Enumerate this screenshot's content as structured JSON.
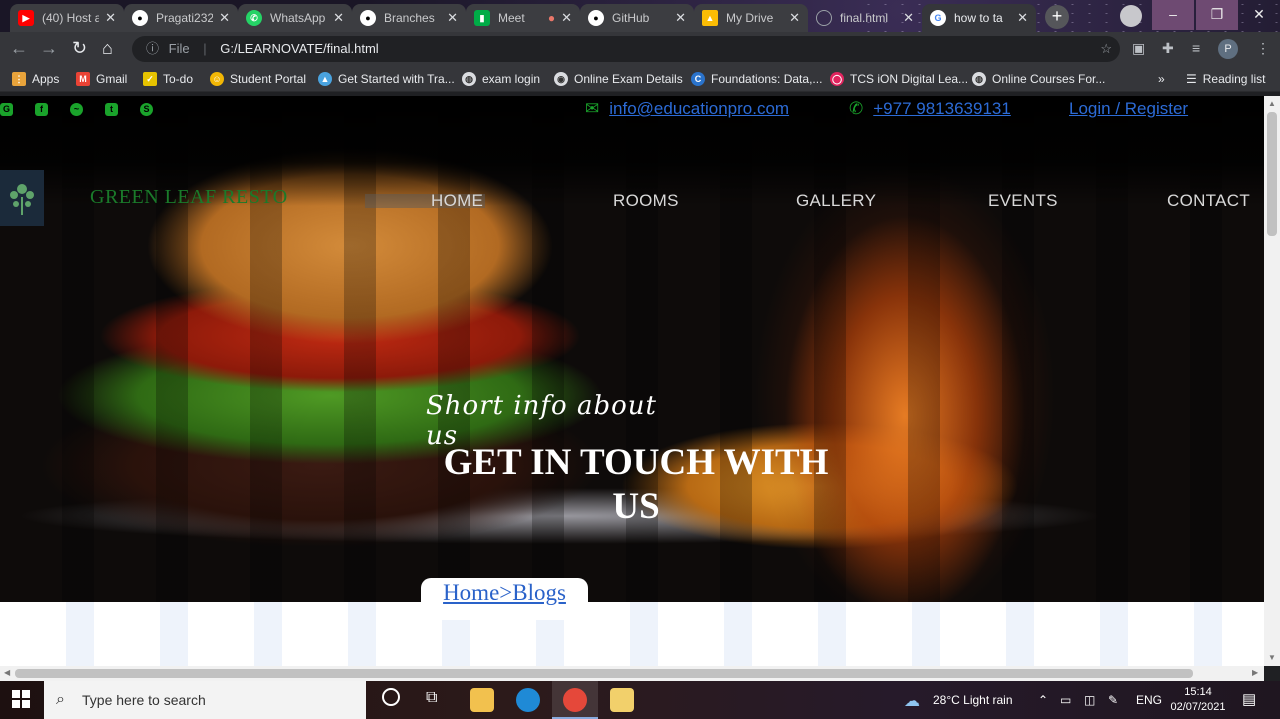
{
  "browser": {
    "tabs": [
      {
        "label": "(40) Host a",
        "icon_color": "#ff0000",
        "icon": "youtube-icon"
      },
      {
        "label": "Pragati232",
        "icon_color": "#ffffff",
        "icon": "github-icon"
      },
      {
        "label": "WhatsApp",
        "icon_color": "#25d366",
        "icon": "whatsapp-icon"
      },
      {
        "label": "Branches",
        "icon_color": "#ffffff",
        "icon": "github-icon"
      },
      {
        "label": "Meet",
        "icon_color": "#00ac47",
        "icon": "meet-icon"
      },
      {
        "label": "GitHub",
        "icon_color": "#ffffff",
        "icon": "github-icon"
      },
      {
        "label": "My Drive",
        "icon_color": "#fbbc04",
        "icon": "drive-icon"
      },
      {
        "label": "final.html",
        "icon_color": "#9aa0a6",
        "icon": "globe-icon"
      },
      {
        "label": "how to ta",
        "icon_color": "#4285f4",
        "icon": "google-icon"
      }
    ],
    "address": {
      "prefix": "File",
      "url": "G:/LEARNOVATE/final.html"
    },
    "profile_initial": "P",
    "bookmarks": [
      {
        "label": "Apps",
        "icon": "apps-grid-icon",
        "color": "#e8a33b"
      },
      {
        "label": "Gmail",
        "icon": "gmail-icon",
        "color": "#ea4335"
      },
      {
        "label": "To-do",
        "icon": "todo-icon",
        "color": "#e6c300"
      },
      {
        "label": "Student Portal",
        "icon": "portal-icon",
        "color": "#f2b705"
      },
      {
        "label": "Get Started with Tra...",
        "icon": "triangle-icon",
        "color": "#4aa3df"
      },
      {
        "label": "exam login",
        "icon": "globe-icon",
        "color": "#dadce0"
      },
      {
        "label": "Online Exam Details",
        "icon": "exam-icon",
        "color": "#dadce0"
      },
      {
        "label": "Foundations: Data,...",
        "icon": "coursera-icon",
        "color": "#2a73cc"
      },
      {
        "label": "TCS iON Digital Lea...",
        "icon": "tcs-icon",
        "color": "#e0245e"
      },
      {
        "label": "Online Courses For...",
        "icon": "globe-icon",
        "color": "#dadce0"
      }
    ],
    "more_bookmarks": "»",
    "reading_list": "Reading list"
  },
  "site": {
    "email": "info@educationpro.com",
    "phone": "+977 9813639131",
    "login": "Login / Register",
    "brand": "GREEN LEAF RESTO",
    "nav": [
      "HOME",
      "ROOMS",
      "GALLERY",
      "EVENTS",
      "CONTACT"
    ],
    "tagline": "Short info about us",
    "headline": "GET IN TOUCH WITH US",
    "breadcrumb": "Home>Blogs",
    "social_icons": [
      "google-plus-icon",
      "facebook-icon",
      "messenger-icon",
      "twitter-icon",
      "skype-icon"
    ],
    "accent_green": "#1aa32b",
    "link_blue": "#2c6bd6"
  },
  "taskbar": {
    "search_placeholder": "Type here to search",
    "weather": "28°C  Light rain",
    "language": "ENG",
    "time": "15:14",
    "date": "02/07/2021"
  }
}
